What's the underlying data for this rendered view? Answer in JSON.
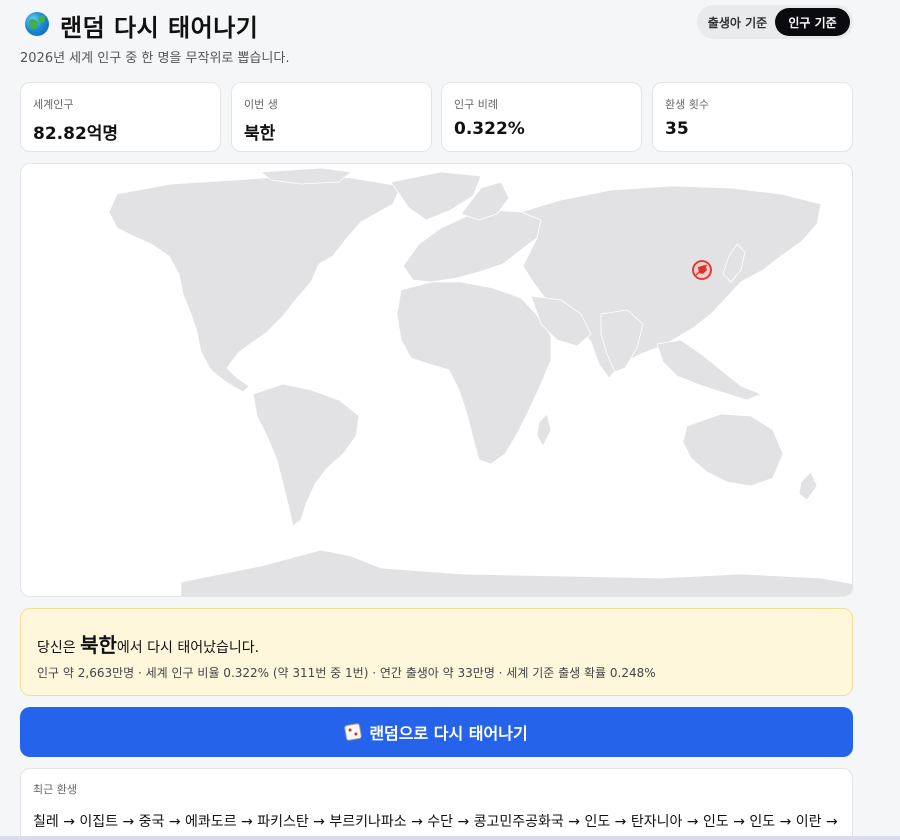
{
  "header": {
    "title": "랜덤 다시 태어나기",
    "subtitle": "2026년 세계 인구 중 한 명을 무작위로 뽑습니다.",
    "logo_icon": "globe-icon",
    "toggle": {
      "options": [
        "출생아 기준",
        "인구 기준"
      ],
      "selected": "인구 기준"
    }
  },
  "stats": [
    {
      "label": "세계인구",
      "value": "82.82억명"
    },
    {
      "label": "이번 생",
      "value": "북한"
    },
    {
      "label": "인구 비례",
      "value": "0.322%"
    },
    {
      "label": "환생 횟수",
      "value": "35"
    }
  ],
  "map": {
    "marker_icon": "location-marker-icon",
    "marker_color": "#d9342b",
    "land_color": "#e4e4e4"
  },
  "result": {
    "prefix": "당신은 ",
    "country": "북한",
    "suffix": "에서 다시 태어났습니다.",
    "details": "인구 약 2,663만명 · 세계 인구 비율 0.322% (약 311번 중 1번) · 연간 출생아 약 33만명 · 세계 기준 출생 확률 0.248%"
  },
  "cta": {
    "label": "랜덤으로 다시 태어나기",
    "icon": "dice-icon",
    "color": "#2563eb"
  },
  "history": {
    "label": "최근 환생",
    "chain": "칠레 → 이집트 → 중국 → 에콰도르 → 파키스탄 → 부르키나파소 → 수단 → 콩고민주공화국 → 인도 → 탄자니아 → 인도 → 인도 → 이란 → 중국 → 북한"
  }
}
